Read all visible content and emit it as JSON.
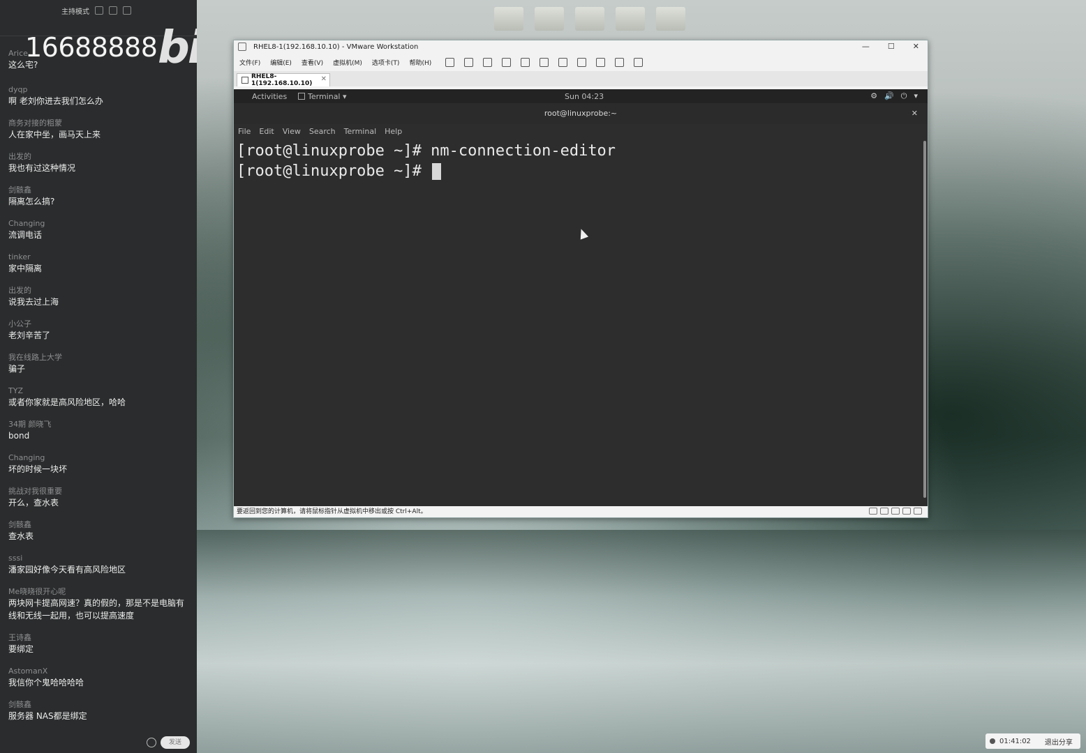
{
  "chat": {
    "header_title": "主持模式",
    "overlay_number": "16688888",
    "overlay_logo": "bilibili",
    "messages": [
      {
        "user": "Arice",
        "text": "这么宅?"
      },
      {
        "user": "dyqp",
        "text": "啊  老刘你进去我们怎么办"
      },
      {
        "user": "商务对接的粗蒙",
        "text": "人在家中坐，画马天上来"
      },
      {
        "user": "出发的",
        "text": "我也有过这种情况"
      },
      {
        "user": "剑骸鑫",
        "text": "隔离怎么搞?"
      },
      {
        "user": "Changing",
        "text": "流调电话"
      },
      {
        "user": "tinker",
        "text": "家中隔离"
      },
      {
        "user": "出发的",
        "text": "说我去过上海"
      },
      {
        "user": "小公子",
        "text": "老刘辛苦了"
      },
      {
        "user": "我在线路上大学",
        "text": "骗子"
      },
      {
        "user": "TYZ",
        "text": "或者你家就是高风险地区，哈哈"
      },
      {
        "user": "34期 颜晓飞",
        "text": "bond"
      },
      {
        "user": "Changing",
        "text": "坏的时候一块坏"
      },
      {
        "user": "挑战对我很重要",
        "text": "开么，查水表"
      },
      {
        "user": "剑骸鑫",
        "text": "查水表"
      },
      {
        "user": "sssi",
        "text": "潘家园好像今天看有高风险地区"
      },
      {
        "user": "Me晓晓很开心呢",
        "text": "两块网卡提高网速？真的假的，那是不是电脑有线和无线一起用，也可以提高速度"
      },
      {
        "user": "王诗鑫",
        "text": "要绑定"
      },
      {
        "user": "AstomanX",
        "text": "我信你个鬼哈哈哈哈"
      },
      {
        "user": "剑骸鑫",
        "text": "服务器 NAS都是绑定"
      }
    ],
    "send_label": "发送"
  },
  "vmware": {
    "window_title": "RHEL8-1(192.168.10.10) - VMware Workstation",
    "menu": [
      "文件(F)",
      "编辑(E)",
      "查看(V)",
      "虚拟机(M)",
      "选项卡(T)",
      "帮助(H)"
    ],
    "tab_label": "RHEL8-1(192.168.10.10)",
    "status_text": "要返回到您的计算机，请将鼠标指针从虚拟机中移出或按 Ctrl+Alt。",
    "win_controls": [
      "—",
      "☐",
      "✕"
    ]
  },
  "guest": {
    "activities": "Activities",
    "app_menu": "Terminal ▾",
    "clock": "Sun 04:23",
    "tray": [
      "⚙",
      "🔊",
      "⏻",
      "▾"
    ],
    "terminal_title": "root@linuxprobe:~",
    "terminal_menu": [
      "File",
      "Edit",
      "View",
      "Search",
      "Terminal",
      "Help"
    ],
    "lines": [
      "[root@linuxprobe ~]# nm-connection-editor",
      "[root@linuxprobe ~]# "
    ]
  },
  "taskbar": {
    "timer": "01:41:02",
    "exit_share": "退出分享"
  }
}
